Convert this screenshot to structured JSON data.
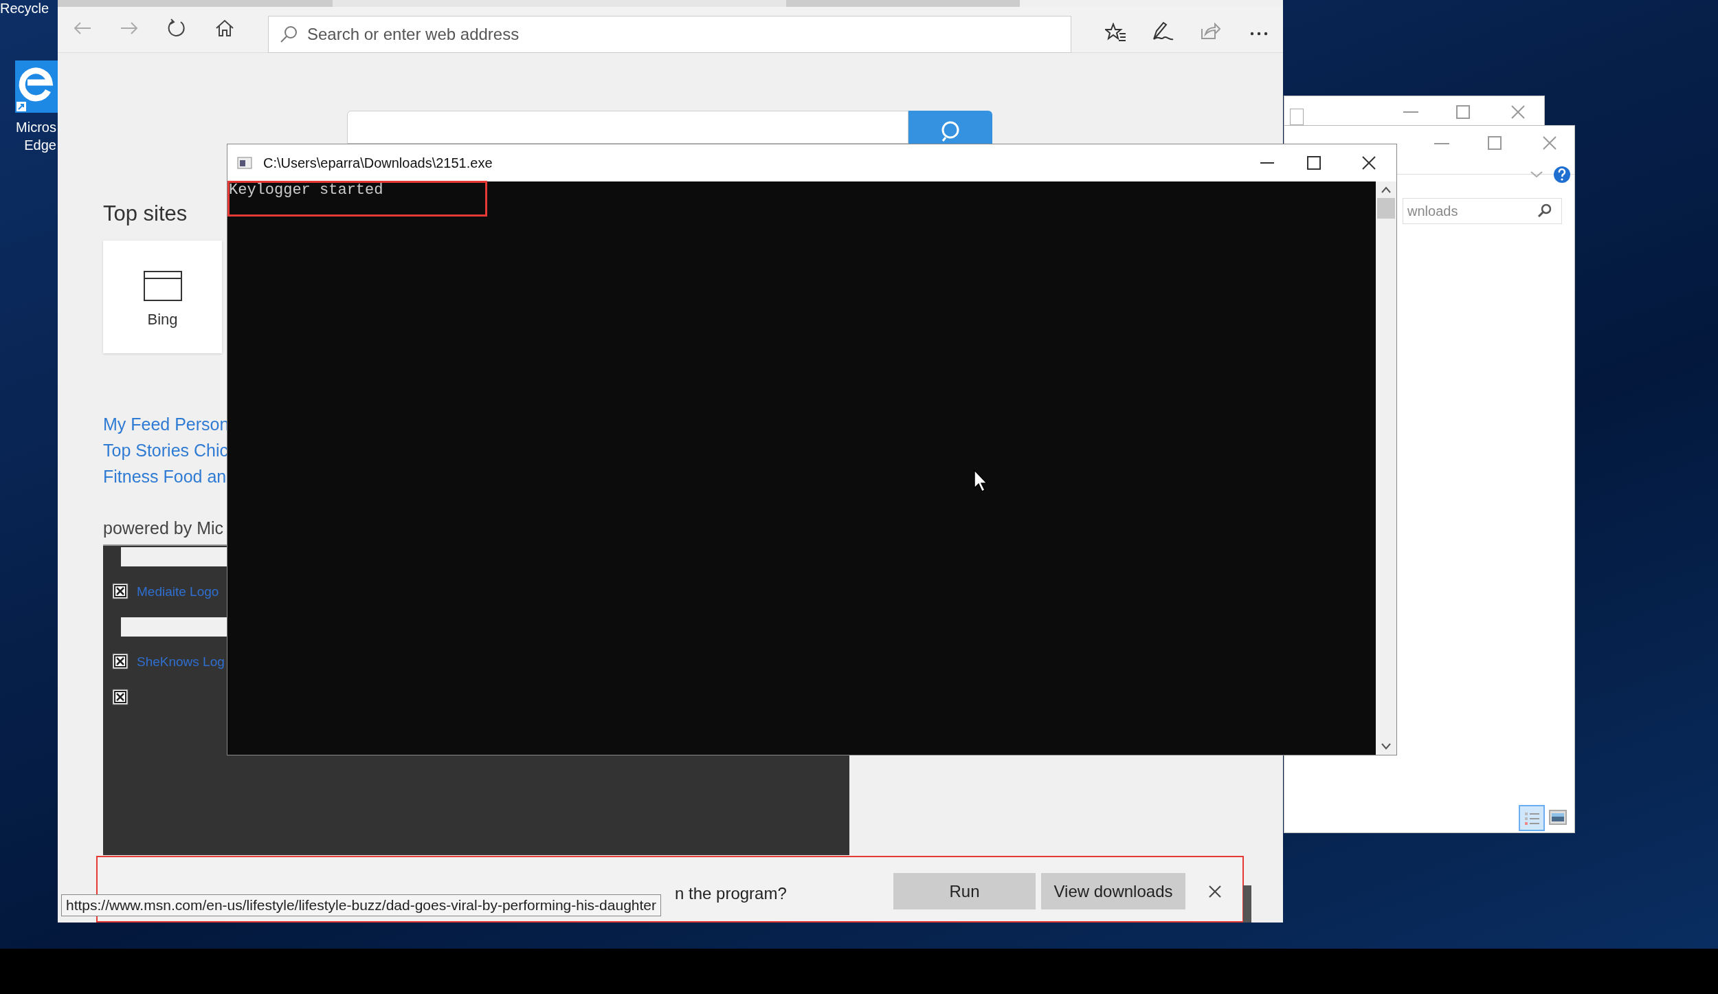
{
  "desktop": {
    "icons": [
      {
        "kind": "recycle",
        "lines": [
          "Recycle"
        ]
      },
      {
        "kind": "edge",
        "lines": [
          "Micros",
          "Edge"
        ]
      }
    ]
  },
  "browser": {
    "tabs": [
      {
        "selected": false
      },
      {
        "selected": true
      },
      {
        "selected": false
      }
    ],
    "address_placeholder": "Search or enter web address",
    "top_sites_heading": "Top sites",
    "top_sites": [
      {
        "label": "Bing"
      }
    ],
    "links": [
      "My Feed Person",
      "Top Stories Chic",
      "Fitness Food an"
    ],
    "powered_by": "powered by Mic",
    "feed_items": [
      {
        "kind": "spacer"
      },
      {
        "kind": "logo",
        "label": "Mediaite Logo"
      },
      {
        "kind": "spacer"
      },
      {
        "kind": "logo",
        "label": "SheKnows Log"
      },
      {
        "kind": "image"
      }
    ],
    "download_bar": {
      "message": "n the program?",
      "buttons": [
        "Run",
        "View downloads"
      ]
    },
    "status_url": "https://www.msn.com/en-us/lifestyle/lifestyle-buzz/dad-goes-viral-by-performing-his-daughter"
  },
  "console": {
    "title": "C:\\Users\\eparra\\Downloads\\2151.exe",
    "lines": [
      "Keylogger started"
    ]
  },
  "explorer": {
    "search_placeholder": "wnloads"
  }
}
